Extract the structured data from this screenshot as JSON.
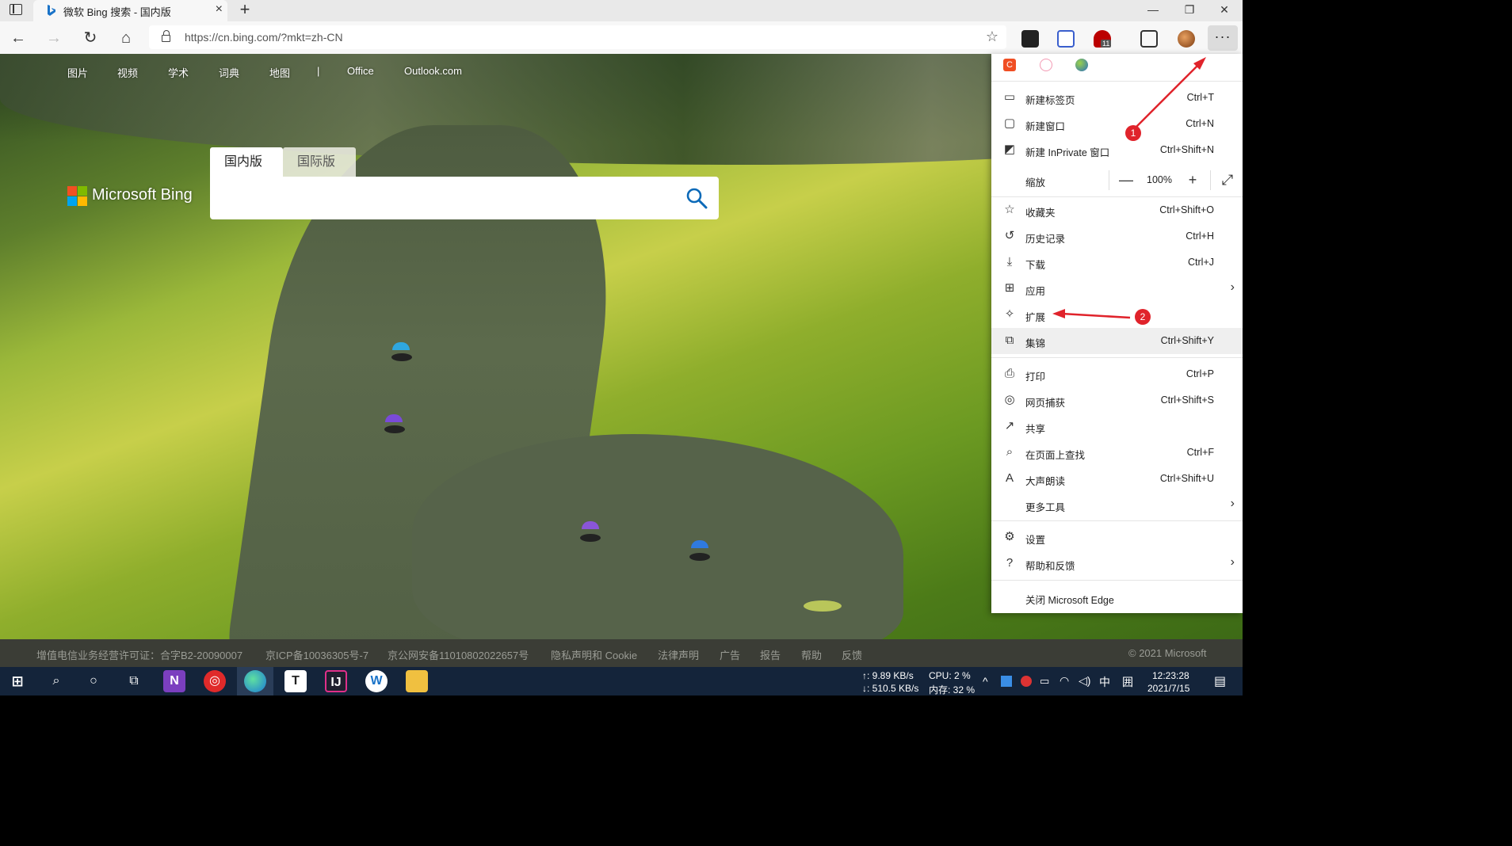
{
  "browser": {
    "tab_title": "微软 Bing 搜索 - 国内版",
    "url": "https://cn.bing.com/?mkt=zh-CN",
    "new_tab_symbol": "+",
    "tab_close_symbol": "×",
    "extension_badge_count": "11"
  },
  "bing": {
    "nav": [
      "图片",
      "视频",
      "学术",
      "词典",
      "地图",
      "|",
      "Office",
      "Outlook.com"
    ],
    "logo_text": "Microsoft Bing",
    "search_tabs": [
      "国内版",
      "国际版"
    ],
    "search_placeholder": ""
  },
  "footer": {
    "links": [
      "增值电信业务经营许可证：合字B2-20090007",
      "京ICP备10036305号-7",
      "京公网安备11010802022657号",
      "隐私声明和 Cookie",
      "法律声明",
      "广告",
      "报告",
      "帮助",
      "反馈"
    ],
    "copyright": "© 2021 Microsoft"
  },
  "menu": {
    "items": [
      {
        "label": "新建标签页",
        "shortcut": "Ctrl+T",
        "icon": "new-tab-icon"
      },
      {
        "label": "新建窗口",
        "shortcut": "Ctrl+N",
        "icon": "new-window-icon"
      },
      {
        "label": "新建 InPrivate 窗口",
        "shortcut": "Ctrl+Shift+N",
        "icon": "inprivate-icon"
      },
      {
        "label": "收藏夹",
        "shortcut": "Ctrl+Shift+O",
        "icon": "favorites-icon"
      },
      {
        "label": "历史记录",
        "shortcut": "Ctrl+H",
        "icon": "history-icon"
      },
      {
        "label": "下载",
        "shortcut": "Ctrl+J",
        "icon": "download-icon"
      },
      {
        "label": "应用",
        "shortcut": "",
        "icon": "apps-icon"
      },
      {
        "label": "扩展",
        "shortcut": "",
        "icon": "extensions-icon"
      },
      {
        "label": "集锦",
        "shortcut": "Ctrl+Shift+Y",
        "icon": "collections-icon"
      },
      {
        "label": "打印",
        "shortcut": "Ctrl+P",
        "icon": "print-icon"
      },
      {
        "label": "网页捕获",
        "shortcut": "Ctrl+Shift+S",
        "icon": "web-capture-icon"
      },
      {
        "label": "共享",
        "shortcut": "",
        "icon": "share-icon"
      },
      {
        "label": "在页面上查找",
        "shortcut": "Ctrl+F",
        "icon": "find-icon"
      },
      {
        "label": "大声朗读",
        "shortcut": "Ctrl+Shift+U",
        "icon": "read-aloud-icon"
      },
      {
        "label": "更多工具",
        "shortcut": "",
        "icon": ""
      },
      {
        "label": "设置",
        "shortcut": "",
        "icon": "settings-icon"
      },
      {
        "label": "帮助和反馈",
        "shortcut": "",
        "icon": "help-icon"
      },
      {
        "label": "关闭 Microsoft Edge",
        "shortcut": "",
        "icon": ""
      }
    ],
    "zoom_label": "缩放",
    "zoom_value": "100%",
    "zoom_minus": "—",
    "zoom_plus": "+"
  },
  "annotations": {
    "badge1": "1",
    "badge2": "2"
  },
  "taskbar": {
    "net_up": "↑: 9.89 KB/s",
    "net_down": "↓: 510.5 KB/s",
    "cpu": "CPU: 2 %",
    "mem": "内存: 32 %",
    "ime": "中",
    "ime2": "囲",
    "time": "12:23:28",
    "date": "2021/7/15"
  }
}
